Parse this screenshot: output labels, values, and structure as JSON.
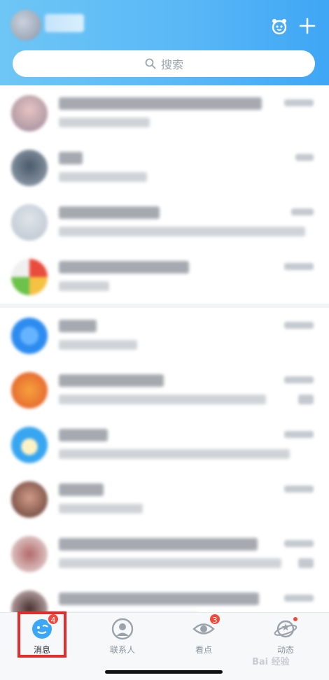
{
  "header": {
    "alarm_icon": "alarm-icon",
    "add_icon": "plus-icon"
  },
  "search": {
    "placeholder": "搜索"
  },
  "tabs": [
    {
      "label": "消息",
      "badge": "4",
      "icon": "message-icon",
      "active": true
    },
    {
      "label": "联系人",
      "icon": "contacts-icon",
      "active": false
    },
    {
      "label": "看点",
      "badge": "3",
      "icon": "eye-icon",
      "active": false
    },
    {
      "label": "动态",
      "icon": "planet-icon",
      "dot": true,
      "active": false
    }
  ],
  "colors": {
    "header_start": "#6ec6f5",
    "header_end": "#3fa6f5",
    "badge": "#f5483d",
    "highlight": "#e32d2d"
  },
  "watermark": "Bai 经验"
}
